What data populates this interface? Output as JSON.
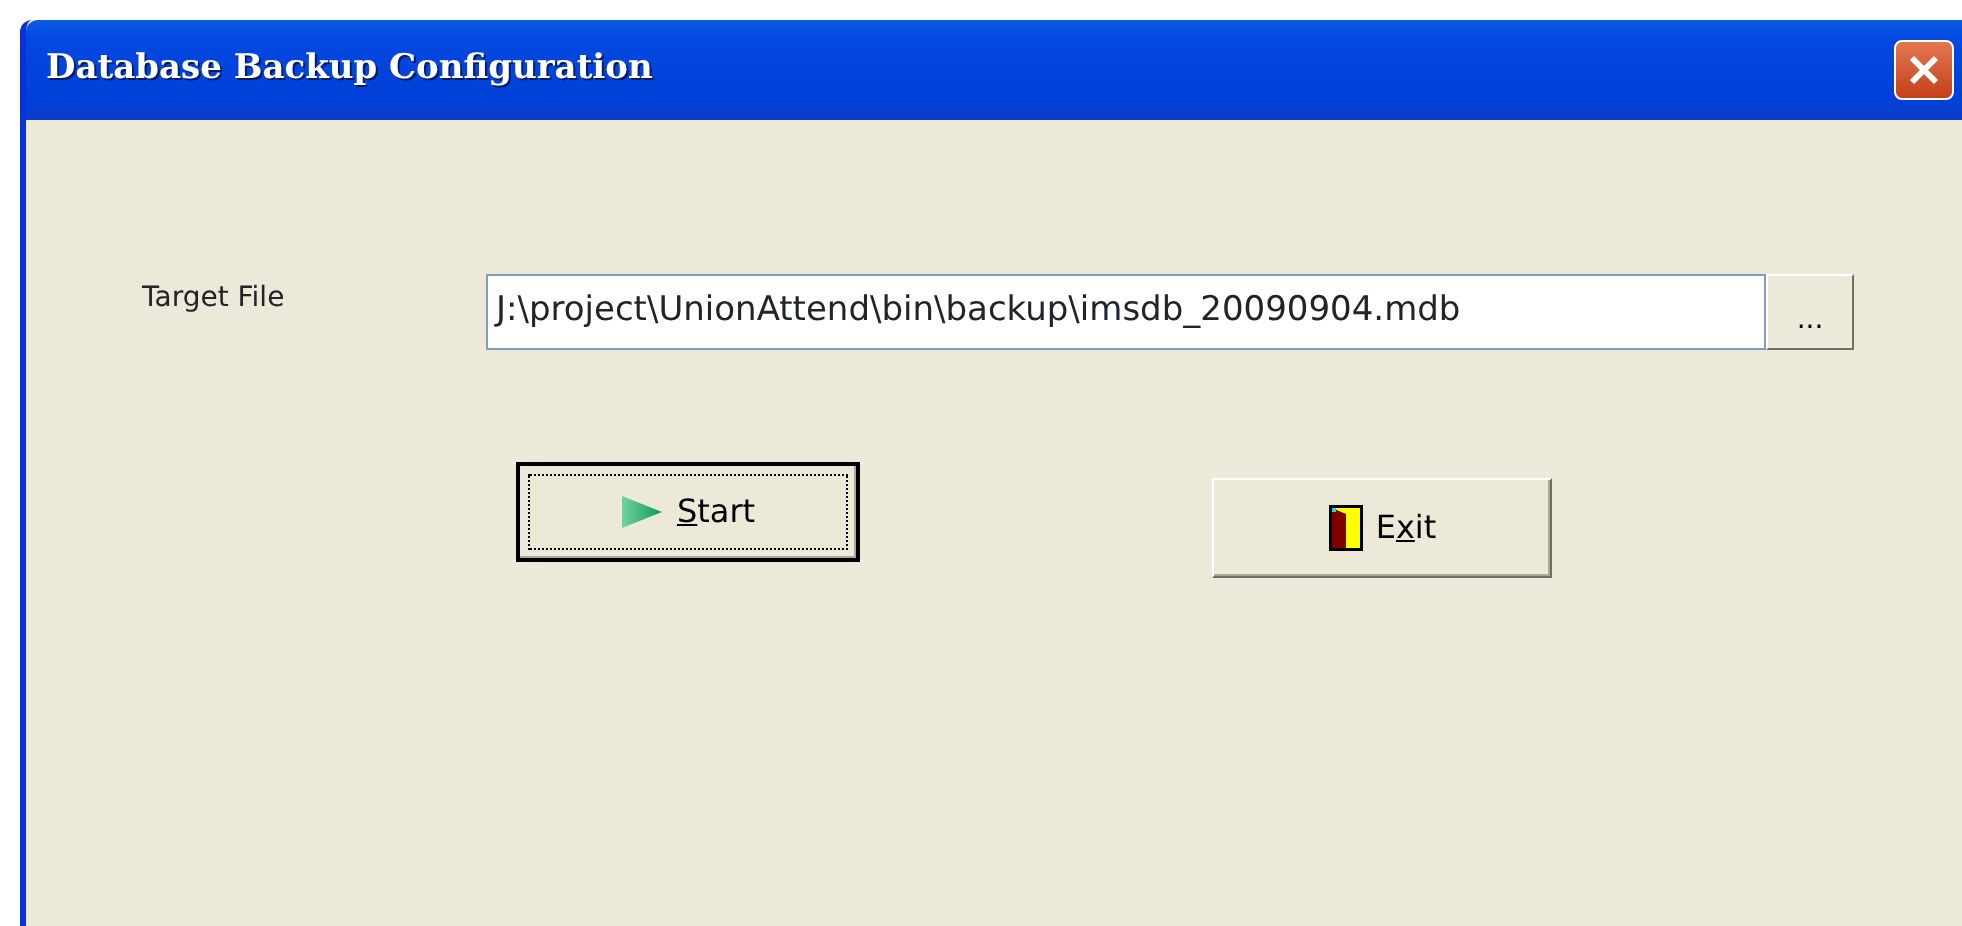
{
  "window": {
    "title": "Database Backup Configuration"
  },
  "target_file": {
    "label": "Target File",
    "value": "J:\\project\\UnionAttend\\bin\\backup\\imsdb_20090904.mdb",
    "browse": "..."
  },
  "buttons": [
    {
      "kind": "start",
      "access_key": "S",
      "label_rest": "tart",
      "focused": true
    },
    {
      "kind": "exit",
      "label_start": "E",
      "access_key": "x",
      "label_rest": "it",
      "focused": false
    }
  ]
}
